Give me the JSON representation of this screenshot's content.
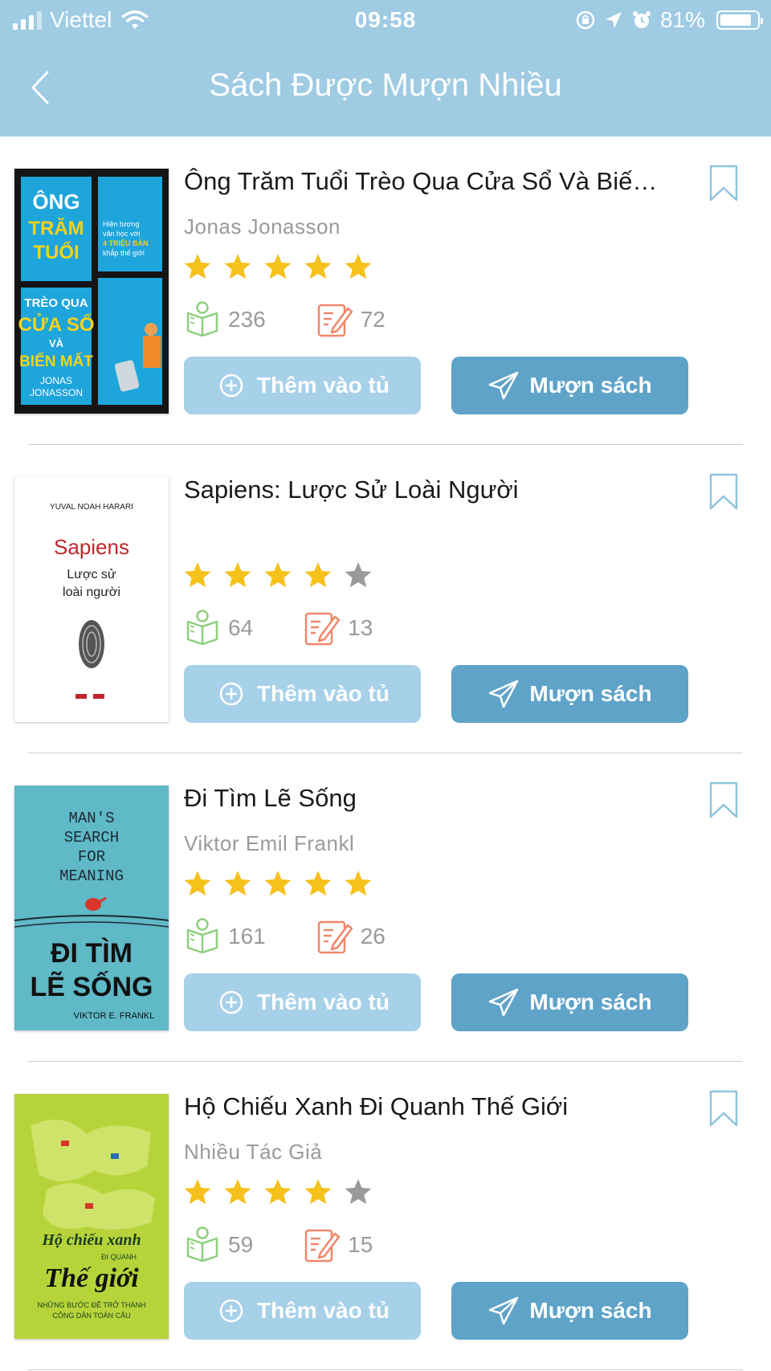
{
  "status_bar": {
    "carrier": "Viettel",
    "time": "09:58",
    "battery": "81%"
  },
  "header": {
    "title": "Sách Được Mượn Nhiều"
  },
  "colors": {
    "header_bg": "#9fcbe3",
    "add_button": "#a7d0e9",
    "borrow_button": "#5fa3c8",
    "star_filled": "#f5c11a",
    "star_empty": "#9a9a9a",
    "read_icon": "#8dcf7d",
    "review_icon": "#f0876a"
  },
  "books": [
    {
      "title": "Ông Trăm Tuổi Trèo Qua Cửa Sổ Và Biến...",
      "author": "Jonas Jonasson",
      "rating": 5,
      "reads": "236",
      "reviews": "72",
      "add_label": "Thêm vào tủ",
      "borrow_label": "Mượn sách",
      "cover": {
        "l1": "ÔNG",
        "l2": "TRĂM",
        "l3": "TUỔI",
        "l4": "TRÈO QUA",
        "l5": "CỬA SỔ",
        "l6": "VÀ",
        "l7": "BIẾN MẤT",
        "l8": "JONAS",
        "l9": "JONASSON",
        "side1": "Hiện tượng",
        "side2": "văn học với",
        "side3": "4 TRIỆU BẢN",
        "side4": "khắp thế giới"
      }
    },
    {
      "title": "Sapiens: Lược Sử Loài Người",
      "author": "",
      "rating": 4,
      "reads": "64",
      "reviews": "13",
      "add_label": "Thêm vào tủ",
      "borrow_label": "Mượn sách",
      "cover": {
        "l1": "YUVAL NOAH HARARI",
        "l2": "Sapiens",
        "l3": "Lược sử",
        "l4": "loài người"
      }
    },
    {
      "title": "Đi Tìm Lẽ Sống",
      "author": "Viktor Emil Frankl",
      "rating": 5,
      "reads": "161",
      "reviews": "26",
      "add_label": "Thêm vào tủ",
      "borrow_label": "Mượn sách",
      "cover": {
        "l1": "MAN'S",
        "l2": "SEARCH",
        "l3": "FOR",
        "l4": "MEANING",
        "l5": "ĐI TÌM",
        "l6": "LẼ SỐNG",
        "l7": "VIKTOR E. FRANKL"
      }
    },
    {
      "title": "Hộ Chiếu Xanh Đi Quanh Thế Giới",
      "author": "Nhiều Tác Giả",
      "rating": 4,
      "reads": "59",
      "reviews": "15",
      "add_label": "Thêm vào tủ",
      "borrow_label": "Mượn sách",
      "cover": {
        "l1": "Hộ chiếu xanh",
        "l2": "ĐI QUANH",
        "l3": "Thế giới",
        "l4": "NHỮNG BƯỚC ĐỂ TRỞ THÀNH",
        "l5": "CÔNG DÂN TOÀN CẦU"
      }
    }
  ]
}
